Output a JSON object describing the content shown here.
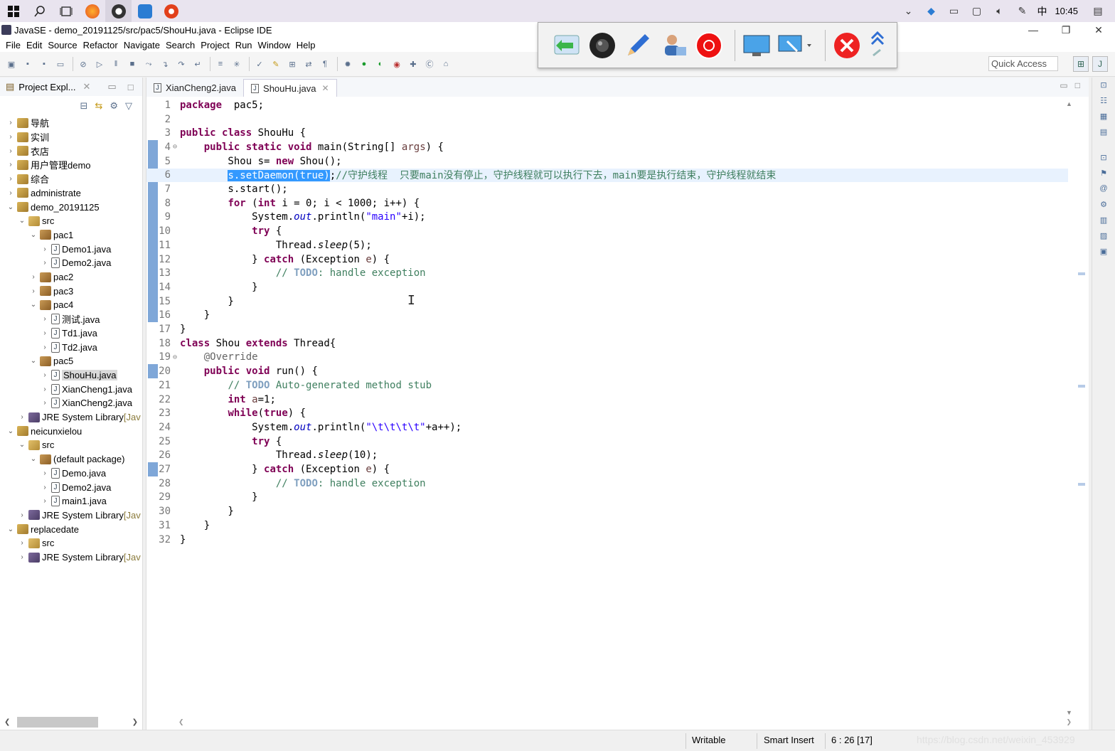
{
  "taskbar": {
    "clock": "10:45",
    "ime": "中",
    "icons": [
      "windows-start-icon",
      "search-icon",
      "task-view-icon",
      "firefox-icon",
      "obs-icon",
      "word-icon",
      "recorder-icon"
    ]
  },
  "window": {
    "title": "JavaSE - demo_20191125/src/pac5/ShouHu.java - Eclipse IDE",
    "minimize": "—",
    "restore": "❐",
    "close": "✕"
  },
  "menu": [
    "File",
    "Edit",
    "Source",
    "Refactor",
    "Navigate",
    "Search",
    "Project",
    "Run",
    "Window",
    "Help"
  ],
  "toolbar": {
    "quick_access": "Quick Access"
  },
  "explorer": {
    "title": "Project Expl...",
    "tree": [
      {
        "label": "导航",
        "level": 0,
        "icon": "project",
        "expanded": false
      },
      {
        "label": "实训",
        "level": 0,
        "icon": "project",
        "expanded": false
      },
      {
        "label": "衣店",
        "level": 0,
        "icon": "project",
        "expanded": false
      },
      {
        "label": "用户管理demo",
        "level": 0,
        "icon": "project",
        "expanded": false
      },
      {
        "label": "综合",
        "level": 0,
        "icon": "project",
        "expanded": false
      },
      {
        "label": "administrate",
        "level": 0,
        "icon": "project",
        "expanded": false
      },
      {
        "label": "demo_20191125",
        "level": 0,
        "icon": "project",
        "expanded": true
      },
      {
        "label": "src",
        "level": 1,
        "icon": "folder",
        "expanded": true
      },
      {
        "label": "pac1",
        "level": 2,
        "icon": "package",
        "expanded": true
      },
      {
        "label": "Demo1.java",
        "level": 3,
        "icon": "java",
        "expanded": false
      },
      {
        "label": "Demo2.java",
        "level": 3,
        "icon": "java",
        "expanded": false
      },
      {
        "label": "pac2",
        "level": 2,
        "icon": "package",
        "expanded": false
      },
      {
        "label": "pac3",
        "level": 2,
        "icon": "package",
        "expanded": false
      },
      {
        "label": "pac4",
        "level": 2,
        "icon": "package",
        "expanded": true
      },
      {
        "label": "测试.java",
        "level": 3,
        "icon": "java",
        "expanded": false
      },
      {
        "label": "Td1.java",
        "level": 3,
        "icon": "java",
        "expanded": false
      },
      {
        "label": "Td2.java",
        "level": 3,
        "icon": "java",
        "expanded": false
      },
      {
        "label": "pac5",
        "level": 2,
        "icon": "package",
        "expanded": true
      },
      {
        "label": "ShouHu.java",
        "level": 3,
        "icon": "java",
        "expanded": false,
        "selected": true
      },
      {
        "label": "XianCheng1.java",
        "level": 3,
        "icon": "java",
        "expanded": false
      },
      {
        "label": "XianCheng2.java",
        "level": 3,
        "icon": "java",
        "expanded": false
      },
      {
        "label": "JRE System Library",
        "suffix": "[Jav",
        "level": 1,
        "icon": "lib",
        "expanded": false
      },
      {
        "label": "neicunxielou",
        "level": 0,
        "icon": "project",
        "expanded": true
      },
      {
        "label": "src",
        "level": 1,
        "icon": "folder",
        "expanded": true
      },
      {
        "label": "(default package)",
        "level": 2,
        "icon": "package",
        "expanded": true
      },
      {
        "label": "Demo.java",
        "level": 3,
        "icon": "java",
        "expanded": false
      },
      {
        "label": "Demo2.java",
        "level": 3,
        "icon": "java",
        "expanded": false
      },
      {
        "label": "main1.java",
        "level": 3,
        "icon": "java",
        "expanded": false
      },
      {
        "label": "JRE System Library",
        "suffix": "[Jav",
        "level": 1,
        "icon": "lib",
        "expanded": false
      },
      {
        "label": "replacedate",
        "level": 0,
        "icon": "project",
        "expanded": true
      },
      {
        "label": "src",
        "level": 1,
        "icon": "folder",
        "expanded": false
      },
      {
        "label": "JRE System Library",
        "suffix": "[Jav",
        "level": 1,
        "icon": "lib",
        "expanded": false
      }
    ]
  },
  "editor": {
    "tabs": [
      {
        "label": "XianCheng2.java",
        "active": false
      },
      {
        "label": "ShouHu.java",
        "active": true
      }
    ],
    "current_line": 6,
    "lines": [
      {
        "n": "1",
        "fold": "",
        "tokens": [
          [
            "kw",
            "package"
          ],
          [
            "",
            "  pac5;"
          ]
        ]
      },
      {
        "n": "2",
        "fold": "",
        "tokens": []
      },
      {
        "n": "3",
        "fold": "",
        "tokens": [
          [
            "kw",
            "public"
          ],
          [
            "",
            " "
          ],
          [
            "kw",
            "class"
          ],
          [
            "",
            " ShouHu {"
          ]
        ]
      },
      {
        "n": "4",
        "fold": "⊖",
        "tokens": [
          [
            "",
            "    "
          ],
          [
            "kw",
            "public"
          ],
          [
            "",
            " "
          ],
          [
            "kw",
            "static"
          ],
          [
            "",
            " "
          ],
          [
            "kw",
            "void"
          ],
          [
            "",
            " main(String[] "
          ],
          [
            "param",
            "args"
          ],
          [
            "",
            ") {"
          ]
        ]
      },
      {
        "n": "5",
        "fold": "",
        "tokens": [
          [
            "",
            "        Shou "
          ],
          [
            "",
            "s"
          ],
          [
            "",
            "= "
          ],
          [
            "kw",
            "new"
          ],
          [
            "",
            " Shou();"
          ]
        ]
      },
      {
        "n": "6",
        "fold": "",
        "tokens": [
          [
            "",
            "        "
          ],
          [
            "sel",
            "s.setDaemon(true)"
          ],
          [
            "",
            ";"
          ],
          [
            "cm",
            "//守护线程  只要main没有停止，守护线程就可以执行下去，main要是执行结束，守护线程就结束"
          ]
        ]
      },
      {
        "n": "7",
        "fold": "",
        "tokens": [
          [
            "",
            "        s.start();"
          ]
        ]
      },
      {
        "n": "8",
        "fold": "",
        "tokens": [
          [
            "",
            "        "
          ],
          [
            "kw",
            "for"
          ],
          [
            "",
            " ("
          ],
          [
            "kw",
            "int"
          ],
          [
            "",
            " i = 0; i < 1000; i++) {"
          ]
        ]
      },
      {
        "n": "9",
        "fold": "",
        "tokens": [
          [
            "",
            "            System."
          ],
          [
            "fld",
            "out"
          ],
          [
            "",
            ".println("
          ],
          [
            "str",
            "\"main\""
          ],
          [
            "",
            "+i);"
          ]
        ]
      },
      {
        "n": "10",
        "fold": "",
        "tokens": [
          [
            "",
            "            "
          ],
          [
            "kw",
            "try"
          ],
          [
            "",
            " {"
          ]
        ]
      },
      {
        "n": "11",
        "fold": "",
        "tokens": [
          [
            "",
            "                Thread."
          ],
          [
            "stat",
            "sleep"
          ],
          [
            "",
            "(5);"
          ]
        ]
      },
      {
        "n": "12",
        "fold": "",
        "tokens": [
          [
            "",
            "            } "
          ],
          [
            "kw",
            "catch"
          ],
          [
            "",
            " (Exception "
          ],
          [
            "param",
            "e"
          ],
          [
            "",
            ") {"
          ]
        ]
      },
      {
        "n": "13",
        "fold": "",
        "tokens": [
          [
            "",
            "                "
          ],
          [
            "cm",
            "// "
          ],
          [
            "todo",
            "TODO"
          ],
          [
            "cm",
            ": handle exception"
          ]
        ]
      },
      {
        "n": "14",
        "fold": "",
        "tokens": [
          [
            "",
            "            }"
          ]
        ]
      },
      {
        "n": "15",
        "fold": "",
        "tokens": [
          [
            "",
            "        }"
          ]
        ]
      },
      {
        "n": "16",
        "fold": "",
        "tokens": [
          [
            "",
            "    }"
          ]
        ]
      },
      {
        "n": "17",
        "fold": "",
        "tokens": [
          [
            "",
            "}"
          ]
        ]
      },
      {
        "n": "18",
        "fold": "",
        "tokens": [
          [
            "kw",
            "class"
          ],
          [
            "",
            " Shou "
          ],
          [
            "kw",
            "extends"
          ],
          [
            "",
            " Thread{"
          ]
        ]
      },
      {
        "n": "19",
        "fold": "⊖",
        "tokens": [
          [
            "",
            "    "
          ],
          [
            "ann",
            "@Override"
          ]
        ]
      },
      {
        "n": "20",
        "fold": "",
        "tokens": [
          [
            "",
            "    "
          ],
          [
            "kw",
            "public"
          ],
          [
            "",
            " "
          ],
          [
            "kw",
            "void"
          ],
          [
            "",
            " run() {"
          ]
        ]
      },
      {
        "n": "21",
        "fold": "",
        "tokens": [
          [
            "",
            "        "
          ],
          [
            "cm",
            "// "
          ],
          [
            "todo",
            "TODO"
          ],
          [
            "cm",
            " Auto-generated method stub"
          ]
        ]
      },
      {
        "n": "22",
        "fold": "",
        "tokens": [
          [
            "",
            "        "
          ],
          [
            "kw",
            "int"
          ],
          [
            "",
            " "
          ],
          [
            "param",
            "a"
          ],
          [
            "",
            "=1;"
          ]
        ]
      },
      {
        "n": "23",
        "fold": "",
        "tokens": [
          [
            "",
            "        "
          ],
          [
            "kw",
            "while"
          ],
          [
            "",
            "("
          ],
          [
            "kw",
            "true"
          ],
          [
            "",
            ") {"
          ]
        ]
      },
      {
        "n": "24",
        "fold": "",
        "tokens": [
          [
            "",
            "            System."
          ],
          [
            "fld",
            "out"
          ],
          [
            "",
            ".println("
          ],
          [
            "str",
            "\"\\t\\t\\t\\t\""
          ],
          [
            "",
            "+a++);"
          ]
        ]
      },
      {
        "n": "25",
        "fold": "",
        "tokens": [
          [
            "",
            "            "
          ],
          [
            "kw",
            "try"
          ],
          [
            "",
            " {"
          ]
        ]
      },
      {
        "n": "26",
        "fold": "",
        "tokens": [
          [
            "",
            "                Thread."
          ],
          [
            "stat",
            "sleep"
          ],
          [
            "",
            "(10);"
          ]
        ]
      },
      {
        "n": "27",
        "fold": "",
        "tokens": [
          [
            "",
            "            } "
          ],
          [
            "kw",
            "catch"
          ],
          [
            "",
            " (Exception "
          ],
          [
            "param",
            "e"
          ],
          [
            "",
            ") {"
          ]
        ]
      },
      {
        "n": "28",
        "fold": "",
        "tokens": [
          [
            "",
            "                "
          ],
          [
            "cm",
            "// "
          ],
          [
            "todo",
            "TODO"
          ],
          [
            "cm",
            ": handle exception"
          ]
        ]
      },
      {
        "n": "29",
        "fold": "",
        "tokens": [
          [
            "",
            "            }"
          ]
        ]
      },
      {
        "n": "30",
        "fold": "",
        "tokens": [
          [
            "",
            "        }"
          ]
        ]
      },
      {
        "n": "31",
        "fold": "",
        "tokens": [
          [
            "",
            "    }"
          ]
        ]
      },
      {
        "n": "32",
        "fold": "",
        "tokens": [
          [
            "",
            "}"
          ]
        ]
      }
    ]
  },
  "status": {
    "writable": "Writable",
    "insert_mode": "Smart Insert",
    "position": "6 : 26 [17]",
    "watermark": "https://blog.csdn.net/weixin_453929"
  },
  "colors": {
    "keyword": "#7f0055",
    "comment": "#3f7f5f",
    "string": "#2a00ff",
    "selection": "#3399ff",
    "current_line": "#e8f2fe"
  }
}
